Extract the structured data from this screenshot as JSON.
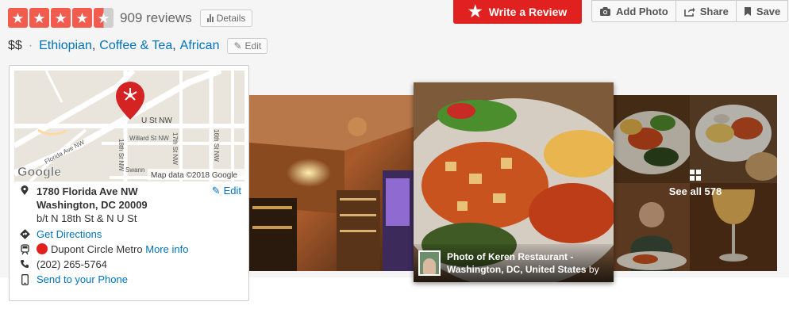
{
  "rating": {
    "stars": 4.5,
    "review_count": "909 reviews",
    "details_label": "Details"
  },
  "categories": {
    "price": "$$",
    "separator": "·",
    "items": [
      "Ethiopian",
      "Coffee & Tea",
      "African"
    ],
    "comma": ",",
    "edit_label": "Edit"
  },
  "actions": {
    "write_review": "Write a Review",
    "add_photo": "Add Photo",
    "share": "Share",
    "save": "Save"
  },
  "map": {
    "street_labels": [
      "U St NW",
      "Willard St NW",
      "Florida Ave NW",
      "18th St NW",
      "17th St NW",
      "16th St NW",
      "Swann"
    ],
    "logo": "Google",
    "attribution": "Map data ©2018 Google",
    "address_line1": "1780 Florida Ave NW",
    "address_line2": "Washington, DC 20009",
    "cross_streets": "b/t N 18th St & N U St",
    "edit_label": "Edit",
    "directions_label": "Get Directions",
    "metro_name": "Dupont Circle Metro",
    "metro_more_info": "More info",
    "phone": "(202) 265-5764",
    "send_to_phone": "Send to your Phone"
  },
  "photos": {
    "caption_line1": "Photo of Keren Restaurant -",
    "caption_line2": "Washington, DC, United States",
    "caption_by": "by",
    "see_all": "See all 578"
  },
  "colors": {
    "brand_red": "#e0211f",
    "star_red": "#f15c4f",
    "link_blue": "#0073bb"
  },
  "icons": [
    "star-icon",
    "bar-chart-icon",
    "pencil-icon",
    "camera-icon",
    "share-icon",
    "bookmark-icon",
    "map-pin-icon",
    "directions-icon",
    "train-icon",
    "phone-icon",
    "mobile-icon",
    "grid-icon"
  ]
}
